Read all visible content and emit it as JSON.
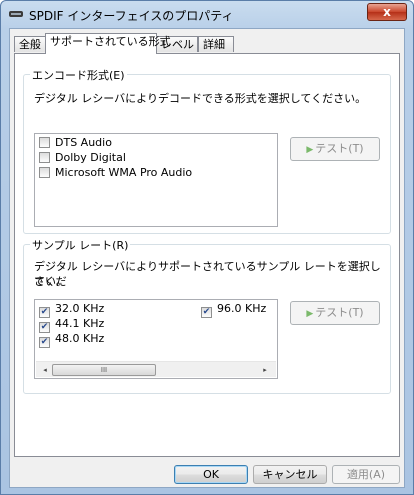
{
  "window": {
    "title": "SPDIF インターフェイスのプロパティ",
    "close_label": "x"
  },
  "tabs": [
    {
      "label": "全般"
    },
    {
      "label": "サポートされている形式"
    },
    {
      "label": "レベル"
    },
    {
      "label": "詳細"
    }
  ],
  "active_tab": 1,
  "encode_group": {
    "title": "エンコード形式(E)",
    "description": "デジタル レシーバによりデコードできる形式を選択してください。",
    "formats": [
      {
        "label": "DTS Audio",
        "checked": false
      },
      {
        "label": "Dolby Digital",
        "checked": false
      },
      {
        "label": "Microsoft WMA Pro Audio",
        "checked": false
      }
    ],
    "test_button": "テスト(T)"
  },
  "sample_group": {
    "title": "サンプル レート(R)",
    "description_line1": "デジタル レシーバによりサポートされているサンプル レートを選択してくだ",
    "description_line2": "さい。",
    "rates": [
      {
        "label": "32.0 KHz",
        "checked": true
      },
      {
        "label": "44.1 KHz",
        "checked": true
      },
      {
        "label": "48.0 KHz",
        "checked": true
      },
      {
        "label": "96.0 KHz",
        "checked": true
      }
    ],
    "test_button": "テスト(T)",
    "scroll_left": "◂",
    "scroll_right": "▸",
    "scroll_grip": "III"
  },
  "footer": {
    "ok": "OK",
    "cancel": "キャンセル",
    "apply": "適用(A)"
  },
  "colors": {
    "title_bg": "#b8cfe8",
    "close": "#c9452b",
    "panel": "#ffffff",
    "client": "#f0f0f0"
  }
}
